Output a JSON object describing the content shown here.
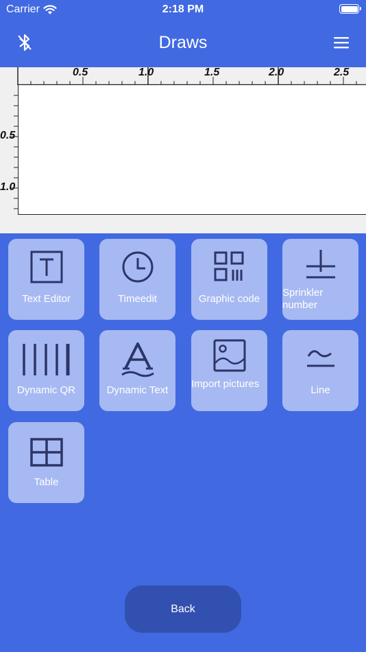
{
  "status": {
    "carrier": "Carrier",
    "time": "2:18 PM",
    "battery_level": 1.0
  },
  "nav": {
    "title": "Draws",
    "left_icon": "bluetooth-icon",
    "right_icon": "menu-icon"
  },
  "ruler": {
    "top_labels": [
      "0.5",
      "1.0",
      "1.5",
      "2.0",
      "2.5"
    ],
    "left_labels": [
      "0.5",
      "1.0"
    ]
  },
  "tools": [
    {
      "label": "Text Editor",
      "icon": "text-editor-icon"
    },
    {
      "label": "Timeedit",
      "icon": "clock-icon"
    },
    {
      "label": "Graphic code",
      "icon": "qr-code-icon"
    },
    {
      "label": "Sprinkler number",
      "icon": "sprinkler-number-icon"
    },
    {
      "label": "Dynamic QR",
      "icon": "barcode-icon"
    },
    {
      "label": "Dynamic Text",
      "icon": "dynamic-text-icon"
    },
    {
      "label": "Import pictures",
      "icon": "image-icon"
    },
    {
      "label": "Line",
      "icon": "line-icon"
    },
    {
      "label": "Table",
      "icon": "table-icon"
    }
  ],
  "back_label": "Back",
  "colors": {
    "background": "#4169e1",
    "tile": "#a7b9f2",
    "icon": "#2c3568",
    "back_button": "#3250b0"
  }
}
